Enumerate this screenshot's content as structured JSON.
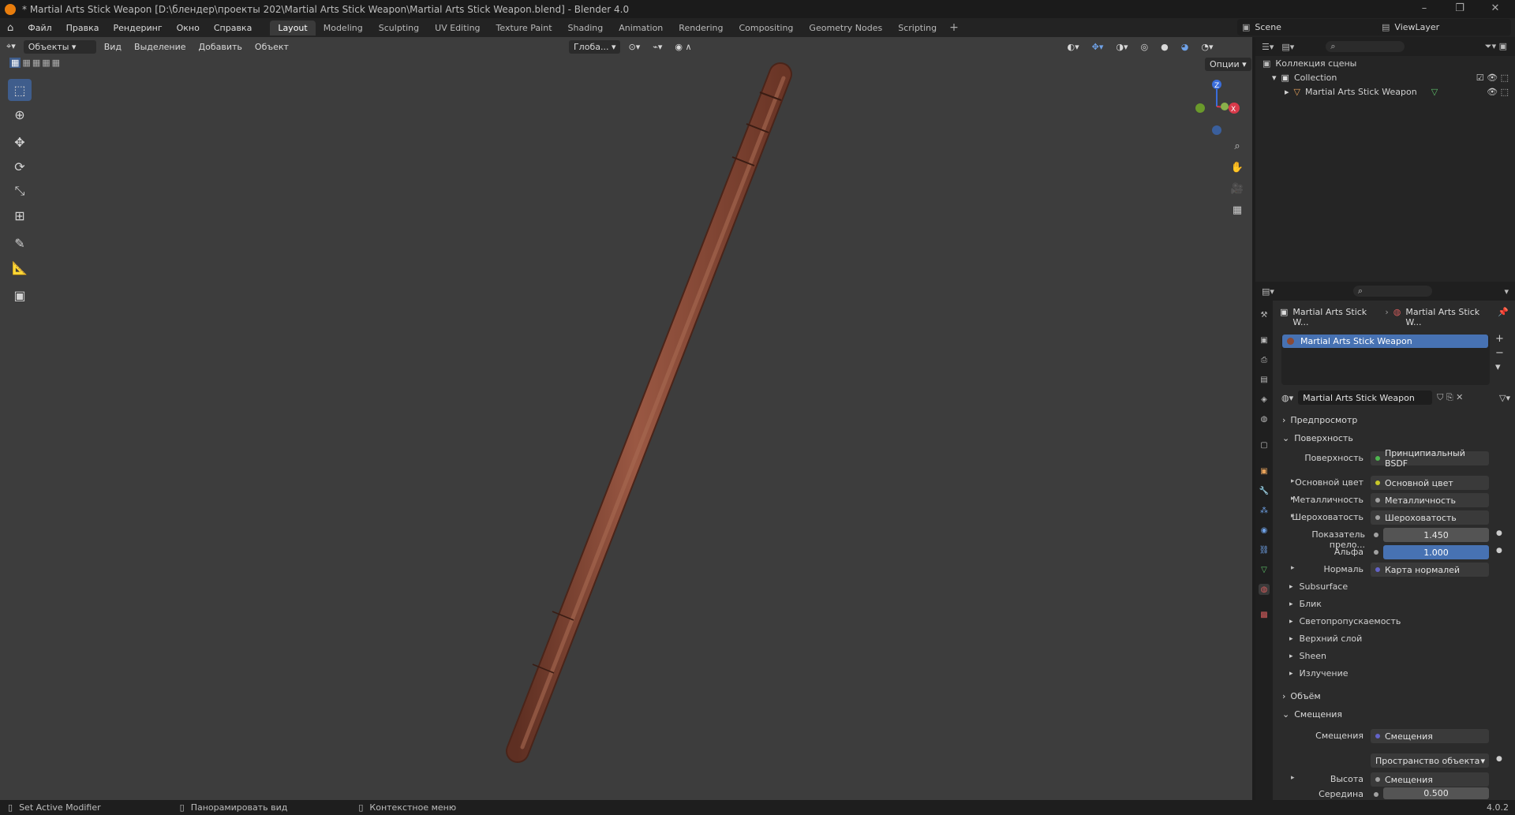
{
  "window": {
    "title": "* Martial Arts Stick Weapon [D:\\блендер\\проекты 202\\Martial Arts Stick Weapon\\Martial Arts Stick Weapon.blend] - Blender 4.0",
    "controls": [
      "–",
      "❐",
      "✕"
    ]
  },
  "menus": [
    "Файл",
    "Правка",
    "Рендеринг",
    "Окно",
    "Справка"
  ],
  "workspaces": [
    "Layout",
    "Modeling",
    "Sculpting",
    "UV Editing",
    "Texture Paint",
    "Shading",
    "Animation",
    "Rendering",
    "Compositing",
    "Geometry Nodes",
    "Scripting"
  ],
  "active_workspace": "Layout",
  "scene": "Scene",
  "viewlayer": "ViewLayer",
  "viewport": {
    "mode": "Объекты",
    "menu": [
      "Вид",
      "Выделение",
      "Добавить",
      "Объект"
    ],
    "transform": "Глоба...",
    "options": "Опции",
    "gizmo": {
      "z": "Z",
      "x": "X"
    },
    "background": "#3d3d3d",
    "object_color": "#8a4a36"
  },
  "tools": [
    "select-box-icon",
    "cursor-icon",
    "move-icon",
    "rotate-icon",
    "scale-icon",
    "transform-icon",
    "annotate-icon",
    "measure-icon",
    "add-cube-icon"
  ],
  "outliner": {
    "root": "Коллекция сцены",
    "collection": "Collection",
    "object": "Martial Arts Stick Weapon"
  },
  "properties": {
    "breadcrumb": [
      "Martial Arts Stick W...",
      "Martial Arts Stick W..."
    ],
    "slot": "Martial Arts Stick Weapon",
    "material": "Martial Arts Stick Weapon",
    "sections": {
      "preview": "Предпросмотр",
      "surface": "Поверхность",
      "volume": "Объём",
      "displacement": "Смещения"
    },
    "surface_rows": [
      {
        "label": "Поверхность",
        "value": "Принципиальный BSDF",
        "dot": "#4fb64f"
      },
      {
        "label": "Основной цвет",
        "value": "Основной цвет",
        "dot": "#c7c729"
      },
      {
        "label": "Металличность",
        "value": "Металличность",
        "dot": "#a1a1a1"
      },
      {
        "label": "Шероховатость",
        "value": "Шероховатость",
        "dot": "#a1a1a1"
      },
      {
        "label": "Показатель прело...",
        "value": "1.450",
        "dot": "#a1a1a1"
      },
      {
        "label": "Альфа",
        "value": "1.000",
        "dot": "#a1a1a1"
      },
      {
        "label": "Нормаль",
        "value": "Карта нормалей",
        "dot": "#6363c7"
      }
    ],
    "subpanels": [
      "Subsurface",
      "Блик",
      "Светопропускаемость",
      "Верхний слой",
      "Sheen",
      "Излучение"
    ],
    "displacement_rows": [
      {
        "label": "Смещения",
        "value": "Смещения",
        "dot": "#6363c7"
      },
      {
        "label": "",
        "value": "Пространство объекта",
        "dot": ""
      },
      {
        "label": "Высота",
        "value": "Смещения",
        "dot": "#a1a1a1"
      },
      {
        "label": "Середина",
        "value": "0.500",
        "dot": "#a1a1a1"
      }
    ]
  },
  "statusbar": {
    "left": "Set Active Modifier",
    "mid": "Панорамировать вид",
    "right": "Контекстное меню",
    "version": "4.0.2"
  }
}
